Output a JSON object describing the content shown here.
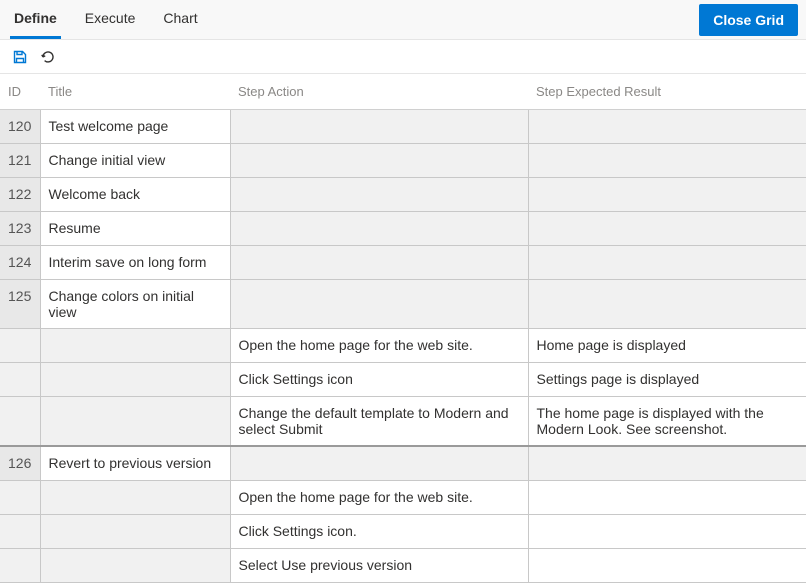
{
  "toolbar": {
    "tabs": [
      {
        "label": "Define",
        "active": true
      },
      {
        "label": "Execute",
        "active": false
      },
      {
        "label": "Chart",
        "active": false
      }
    ],
    "close_label": "Close Grid"
  },
  "icons": {
    "save_work": "save-work-items-icon",
    "refresh": "refresh-icon"
  },
  "columns": {
    "id": "ID",
    "title": "Title",
    "action": "Step Action",
    "result": "Step Expected Result"
  },
  "rows": [
    {
      "type": "parent",
      "id": "120",
      "title": "Test welcome page",
      "action": "",
      "result": ""
    },
    {
      "type": "parent",
      "id": "121",
      "title": "Change initial view",
      "action": "",
      "result": ""
    },
    {
      "type": "parent",
      "id": "122",
      "title": "Welcome back",
      "action": "",
      "result": ""
    },
    {
      "type": "parent",
      "id": "123",
      "title": "Resume",
      "action": "",
      "result": ""
    },
    {
      "type": "parent",
      "id": "124",
      "title": "Interim save on long form",
      "action": "",
      "result": ""
    },
    {
      "type": "parent",
      "id": "125",
      "title": "Change colors on initial view",
      "action": "",
      "result": ""
    },
    {
      "type": "child",
      "id": "",
      "title": "",
      "action": "Open the home page for the web site.",
      "result": "Home page is displayed"
    },
    {
      "type": "child",
      "id": "",
      "title": "",
      "action": "Click Settings icon",
      "result": "Settings page is displayed"
    },
    {
      "type": "child",
      "id": "",
      "title": "",
      "action": "Change the default template to Modern and select Submit",
      "result": "The home page is displayed with the Modern Look. See screenshot."
    },
    {
      "type": "parent",
      "id": "126",
      "title": "Revert to previous version",
      "action": "",
      "result": ""
    },
    {
      "type": "child",
      "id": "",
      "title": "",
      "action": "Open the home page for the web site.",
      "result": ""
    },
    {
      "type": "child",
      "id": "",
      "title": "",
      "action": "Click Settings icon.",
      "result": ""
    },
    {
      "type": "child",
      "id": "",
      "title": "",
      "action": "Select Use previous version",
      "result": ""
    }
  ]
}
